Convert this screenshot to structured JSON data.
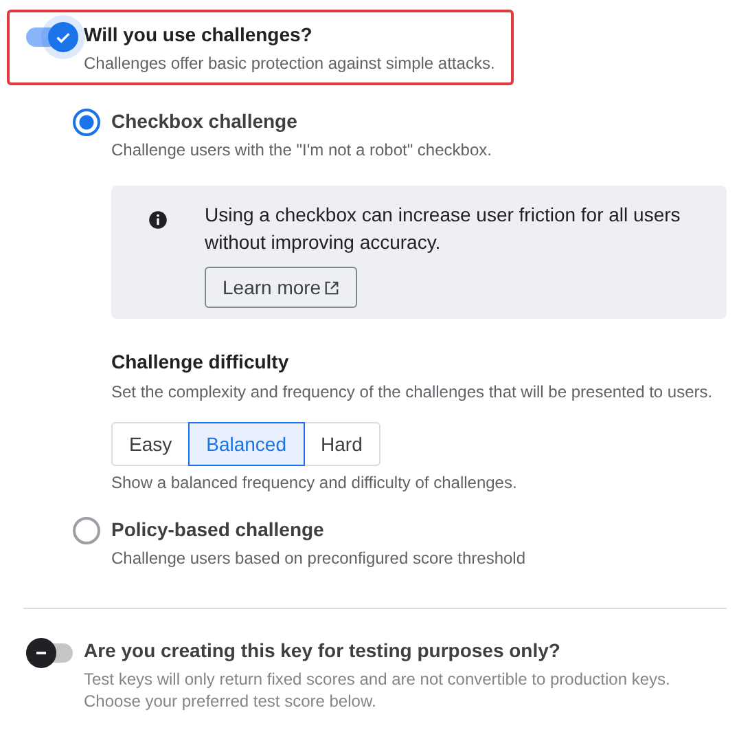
{
  "challenges_toggle": {
    "title": "Will you use challenges?",
    "description": "Challenges offer basic protection against simple attacks.",
    "on": true,
    "highlighted": true
  },
  "challenge_types": [
    {
      "title": "Checkbox challenge",
      "description": "Challenge users with the \"I'm not a robot\" checkbox.",
      "selected": true,
      "kind": "checkbox"
    },
    {
      "title": "Policy-based challenge",
      "description": "Challenge users based on preconfigured score threshold",
      "selected": false,
      "kind": "policy"
    }
  ],
  "info_notice": {
    "text": "Using a checkbox can increase user friction for all users without improving accuracy.",
    "button": "Learn more"
  },
  "difficulty": {
    "title": "Challenge difficulty",
    "description": "Set the complexity and frequency of the challenges that will be presented to users.",
    "options": [
      {
        "label": "Easy",
        "selected": false
      },
      {
        "label": "Balanced",
        "selected": true
      },
      {
        "label": "Hard",
        "selected": false
      }
    ],
    "hint": "Show a balanced frequency and difficulty of challenges."
  },
  "testing_toggle": {
    "title": "Are you creating this key for testing purposes only?",
    "description": "Test keys will only return fixed scores and are not convertible to production keys. Choose your preferred test score below.",
    "on": false
  }
}
